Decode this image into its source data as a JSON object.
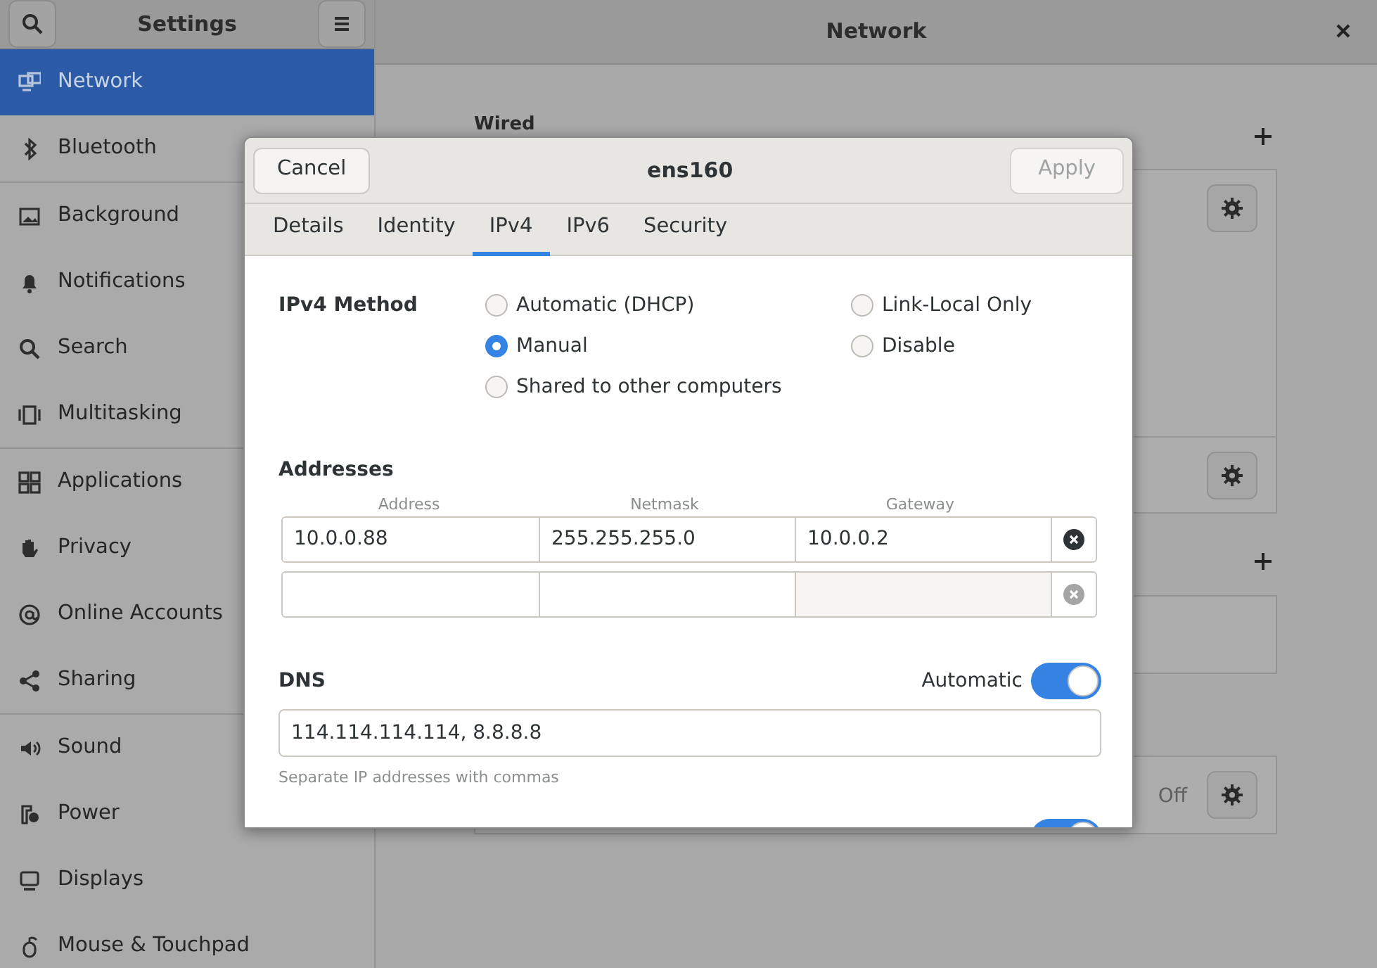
{
  "sidebar_header": {
    "title": "Settings"
  },
  "header": {
    "title": "Network"
  },
  "sidebar": {
    "groups": [
      {
        "items": [
          {
            "label": "Network",
            "selected": true
          },
          {
            "label": "Bluetooth",
            "selected": false
          }
        ]
      },
      {
        "items": [
          {
            "label": "Background",
            "selected": false
          },
          {
            "label": "Notifications",
            "selected": false
          },
          {
            "label": "Search",
            "selected": false
          },
          {
            "label": "Multitasking",
            "selected": false
          }
        ]
      },
      {
        "items": [
          {
            "label": "Applications",
            "selected": false
          },
          {
            "label": "Privacy",
            "selected": false
          },
          {
            "label": "Online Accounts",
            "selected": false
          },
          {
            "label": "Sharing",
            "selected": false
          }
        ]
      },
      {
        "items": [
          {
            "label": "Sound",
            "selected": false
          },
          {
            "label": "Power",
            "selected": false
          },
          {
            "label": "Displays",
            "selected": false
          },
          {
            "label": "Mouse & Touchpad",
            "selected": false
          }
        ]
      }
    ]
  },
  "panel": {
    "sections": [
      {
        "title": "Wired",
        "add_button": true,
        "rows": [
          {
            "kind": "tall",
            "gear": true
          },
          {
            "kind": "short",
            "gear": true
          }
        ]
      },
      {
        "add_button": true,
        "rows": [
          {
            "kind": "short",
            "gear": false
          }
        ]
      },
      {
        "add_button": false,
        "rows": [
          {
            "kind": "short",
            "gear": true,
            "status": "Off"
          }
        ]
      }
    ]
  },
  "dialog": {
    "title": "ens160",
    "cancel": "Cancel",
    "apply": {
      "label": "Apply",
      "disabled": true
    },
    "tabs": [
      {
        "label": "Details",
        "selected": false
      },
      {
        "label": "Identity",
        "selected": false
      },
      {
        "label": "IPv4",
        "selected": true
      },
      {
        "label": "IPv6",
        "selected": false
      },
      {
        "label": "Security",
        "selected": false
      }
    ],
    "method": {
      "label": "IPv4 Method",
      "options": [
        {
          "label": "Automatic (DHCP)",
          "selected": false
        },
        {
          "label": "Manual",
          "selected": true
        },
        {
          "label": "Shared to other computers",
          "selected": false
        },
        {
          "label": "Link-Local Only",
          "selected": false
        },
        {
          "label": "Disable",
          "selected": false
        }
      ]
    },
    "addresses": {
      "title": "Addresses",
      "columns": [
        "Address",
        "Netmask",
        "Gateway"
      ],
      "rows": [
        {
          "kind": "entry",
          "cells": [
            "10.0.0.88",
            "255.255.255.0",
            "10.0.0.2"
          ]
        },
        {
          "kind": "blank"
        }
      ]
    },
    "dns": {
      "title": "DNS",
      "automatic_label": "Automatic",
      "automatic": true,
      "value": "114.114.114.114, 8.8.8.8",
      "hint": "Separate IP addresses with commas"
    },
    "routes_toggle": {
      "on": true
    }
  }
}
